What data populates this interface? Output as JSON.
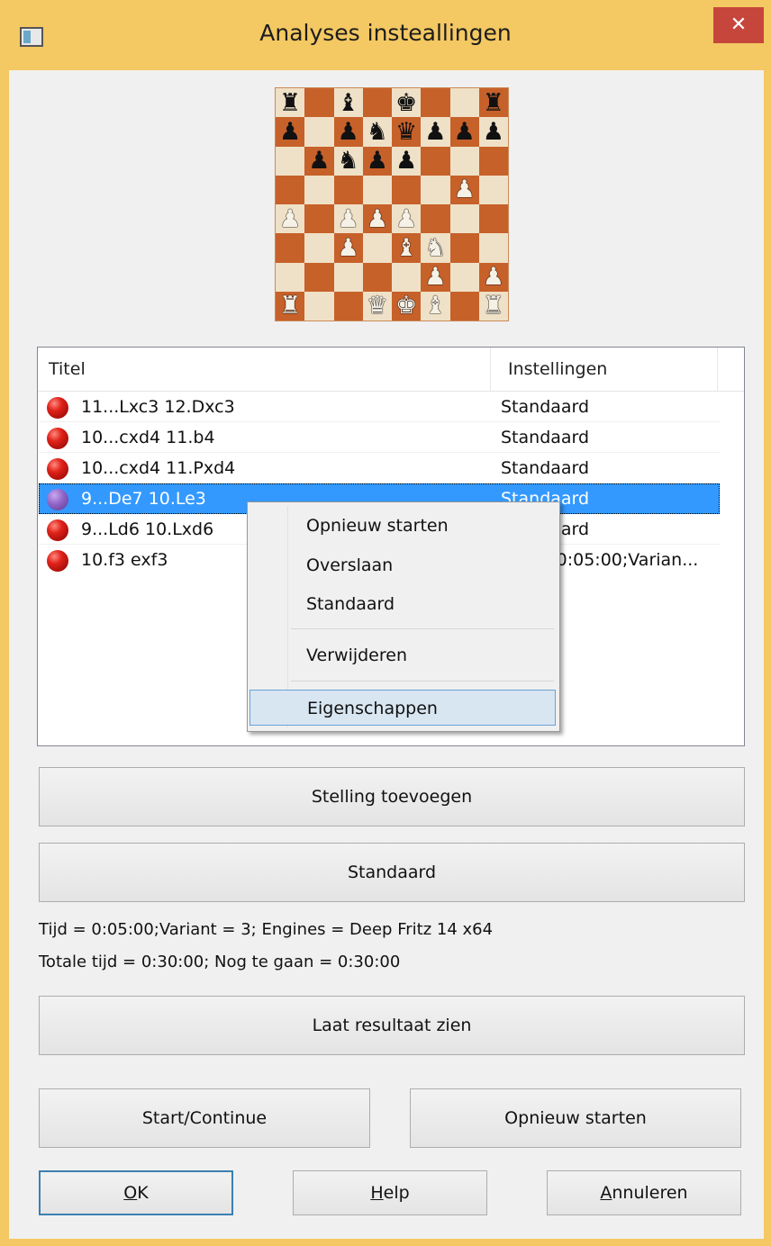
{
  "window": {
    "title": "Analyses insteallingen",
    "close_glyph": "✕"
  },
  "board": [
    [
      "r",
      "",
      "b",
      "",
      "k",
      "",
      "",
      "r"
    ],
    [
      "p",
      "",
      "p",
      "n",
      "q",
      "p",
      "p",
      "p"
    ],
    [
      "",
      "p",
      "n",
      "p",
      "p",
      "",
      "",
      ""
    ],
    [
      "",
      "",
      "",
      "",
      "",
      "",
      "P",
      ""
    ],
    [
      "P",
      "",
      "P",
      "P",
      "P",
      "",
      "",
      ""
    ],
    [
      "",
      "",
      "P",
      "",
      "B",
      "N",
      "",
      ""
    ],
    [
      "",
      "",
      "",
      "",
      "",
      "P",
      "",
      "P"
    ],
    [
      "R",
      "",
      "",
      "Q",
      "K",
      "B",
      "",
      "R"
    ]
  ],
  "list": {
    "columns": {
      "title": "Titel",
      "settings": "Instellingen"
    },
    "rows": [
      {
        "title": "11...Lxc3 12.Dxc3",
        "settings": "Standaard"
      },
      {
        "title": "10...cxd4 11.b4",
        "settings": "Standaard"
      },
      {
        "title": "10...cxd4 11.Pxd4",
        "settings": "Standaard"
      },
      {
        "title": "9...De7 10.Le3",
        "settings": "Standaard"
      },
      {
        "title": "9...Ld6 10.Lxd6",
        "settings": "Standaard"
      },
      {
        "title": "10.f3 exf3",
        "settings": "Tijd = 0:05:00;Varian..."
      }
    ]
  },
  "context_menu": {
    "items": [
      "Opnieuw starten",
      "Overslaan",
      "Standaard",
      "Verwijderen",
      "Eigenschappen"
    ]
  },
  "buttons": {
    "add_position": "Stelling toevoegen",
    "default": "Standaard",
    "show_result": "Laat resultaat zien",
    "start_continue": "Start/Continue",
    "restart": "Opnieuw starten",
    "ok_u": "O",
    "ok_rest": "K",
    "help_u": "H",
    "help_rest": "elp",
    "cancel_u": "A",
    "cancel_rest": "nnuleren"
  },
  "info": {
    "line1": "Tijd = 0:05:00;Variant = 3; Engines = Deep Fritz 14 x64",
    "line2": "Totale tijd = 0:30:00; Nog te gaan = 0:30:00"
  }
}
